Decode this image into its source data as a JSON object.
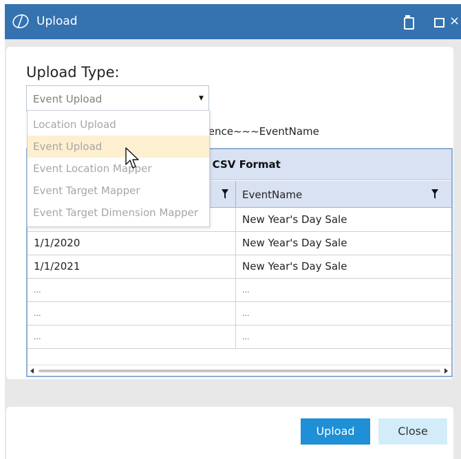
{
  "window": {
    "title": "Upload"
  },
  "form": {
    "upload_type_label": "Upload Type:",
    "selected_value": "Event Upload",
    "hint_text": "rrence~~~EventName"
  },
  "dropdown": {
    "options": [
      {
        "label": "Location Upload"
      },
      {
        "label": "Event Upload"
      },
      {
        "label": "Event Location Mapper"
      },
      {
        "label": "Event Target Mapper"
      },
      {
        "label": "Event Target Dimension Mapper"
      }
    ],
    "highlighted": "Event Upload"
  },
  "grid": {
    "title_visible": "le CSV Format",
    "columns": [
      {
        "label": ""
      },
      {
        "label": "EventName"
      }
    ],
    "rows": [
      {
        "c1": "",
        "c2": "New Year's Day Sale"
      },
      {
        "c1": "1/1/2020",
        "c2": "New Year's Day Sale"
      },
      {
        "c1": "1/1/2021",
        "c2": "New Year's Day Sale"
      },
      {
        "c1": "...",
        "c2": "..."
      },
      {
        "c1": "...",
        "c2": "..."
      },
      {
        "c1": "...",
        "c2": "..."
      }
    ]
  },
  "footer": {
    "upload_label": "Upload",
    "close_label": "Close"
  },
  "colors": {
    "titlebar": "#3572b0",
    "upload_button": "#1f8fd6",
    "close_button": "#d3ecfa",
    "grid_header": "#d8e2f2",
    "dropdown_highlight": "#fdf0d0"
  },
  "icons": {
    "title_logo": "brand-logo-icon",
    "restore": "restore-icon",
    "maximize": "maximize-icon",
    "close": "close-icon",
    "dropdown_arrow": "chevron-down-icon",
    "filter": "filter-icon",
    "cursor": "mouse-pointer-icon"
  }
}
